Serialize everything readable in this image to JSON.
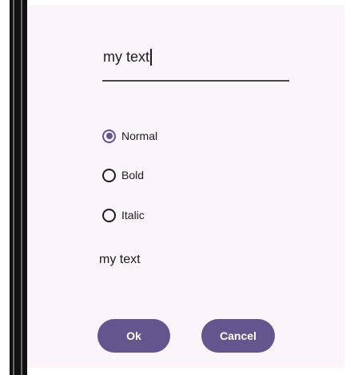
{
  "text_field": {
    "value": "my text"
  },
  "style_options": {
    "items": [
      {
        "label": "Normal",
        "checked": true
      },
      {
        "label": "Bold",
        "checked": false
      },
      {
        "label": "Italic",
        "checked": false
      }
    ]
  },
  "preview": {
    "text": "my text"
  },
  "actions": {
    "ok_label": "Ok",
    "cancel_label": "Cancel"
  },
  "colors": {
    "accent": "#65558f",
    "surface": "#fbf5fb",
    "text": "#1d1b20",
    "underline": "#49454f"
  }
}
